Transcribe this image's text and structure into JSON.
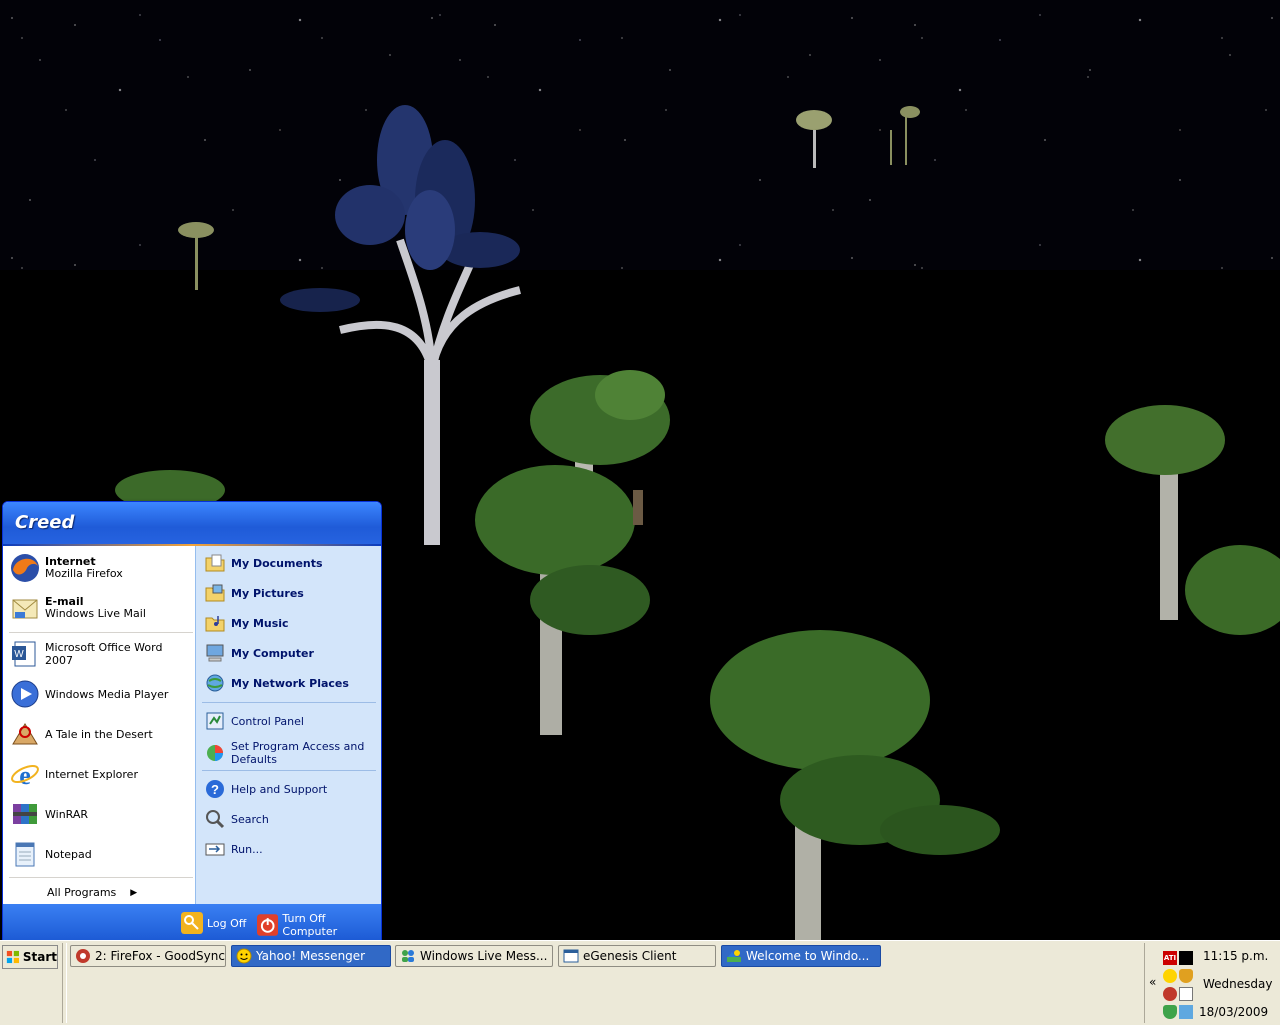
{
  "start_menu": {
    "user": "Creed",
    "pinned": [
      {
        "title": "Internet",
        "subtitle": "Mozilla Firefox",
        "icon": "firefox-icon"
      },
      {
        "title": "E-mail",
        "subtitle": "Windows Live Mail",
        "icon": "mail-icon"
      }
    ],
    "recent": [
      {
        "label": "Microsoft Office Word 2007",
        "icon": "word-icon"
      },
      {
        "label": "Windows Media Player",
        "icon": "media-player-icon"
      },
      {
        "label": "A Tale in the Desert",
        "icon": "game-icon"
      },
      {
        "label": "Internet Explorer",
        "icon": "ie-icon"
      },
      {
        "label": "WinRAR",
        "icon": "winrar-icon"
      },
      {
        "label": "Notepad",
        "icon": "notepad-icon"
      }
    ],
    "all_programs": "All Programs",
    "places": [
      {
        "label": "My Documents",
        "icon": "folder-documents-icon"
      },
      {
        "label": "My Pictures",
        "icon": "folder-pictures-icon"
      },
      {
        "label": "My Music",
        "icon": "folder-music-icon"
      },
      {
        "label": "My Computer",
        "icon": "computer-icon"
      },
      {
        "label": "My Network Places",
        "icon": "network-icon"
      }
    ],
    "settings": [
      {
        "label": "Control Panel",
        "icon": "control-panel-icon"
      },
      {
        "label": "Set Program Access and Defaults",
        "icon": "program-access-icon"
      }
    ],
    "tools": [
      {
        "label": "Help and Support",
        "icon": "help-icon"
      },
      {
        "label": "Search",
        "icon": "search-icon"
      },
      {
        "label": "Run...",
        "icon": "run-icon"
      }
    ],
    "log_off": "Log Off",
    "turn_off": "Turn Off Computer"
  },
  "taskbar": {
    "start_label": "Start",
    "tasks": [
      {
        "label": "2: FireFox - GoodSync",
        "icon": "firefox-icon",
        "active": false
      },
      {
        "label": "Yahoo! Messenger",
        "icon": "yahoo-icon",
        "active": true
      },
      {
        "label": "Windows Live Mess...",
        "icon": "messenger-icon",
        "active": false
      },
      {
        "label": "eGenesis Client",
        "icon": "window-icon",
        "active": false
      },
      {
        "label": "Welcome to Windo...",
        "icon": "windows-icon",
        "active": true
      }
    ],
    "tray_toggle": "«",
    "clock": {
      "time": "11:15 p.m.",
      "day": "Wednesday",
      "date": "18/03/2009"
    }
  },
  "colors": {
    "start_header": "#245edb",
    "taskbar": "#ece9d8",
    "active_task": "#3169c6"
  }
}
